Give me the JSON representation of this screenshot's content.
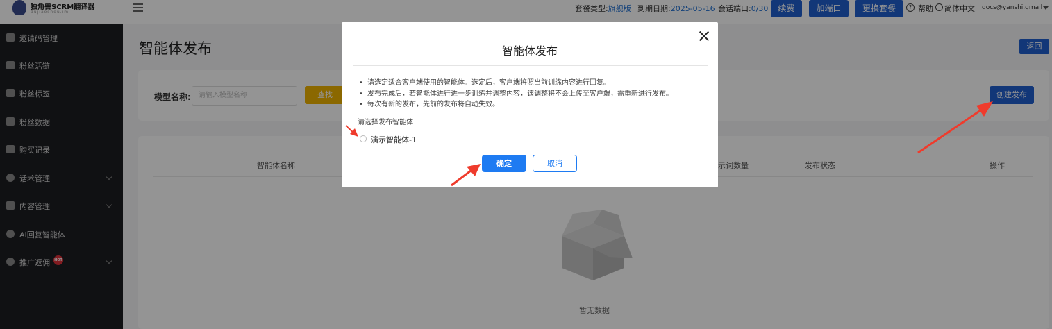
{
  "header": {
    "logo_title": "独角兽SCRM翻译器",
    "logo_subtitle": "dujiaoshou.im",
    "plan_label": "套餐类型:",
    "plan_value": "旗舰版",
    "expiry_label": "到期日期:",
    "expiry_value": "2025-05-16",
    "ports_label": "会话端口:",
    "ports_value": "0/30",
    "renew_button": "续费",
    "add_port_button": "加端口",
    "change_plan_button": "更换套餐",
    "help_label": "帮助",
    "language_label": "简体中文",
    "user_email": "docs@yanshi.gmail"
  },
  "sidebar": {
    "items": [
      {
        "label": "邀请码管理",
        "icon": "invite-icon",
        "has_children": false
      },
      {
        "label": "粉丝活链",
        "icon": "fans-icon",
        "has_children": false
      },
      {
        "label": "粉丝标签",
        "icon": "tag-icon",
        "has_children": false
      },
      {
        "label": "粉丝数据",
        "icon": "chart-icon",
        "has_children": false
      },
      {
        "label": "购买记录",
        "icon": "cart-icon",
        "has_children": false
      },
      {
        "label": "话术管理",
        "icon": "chat-icon",
        "has_children": true
      },
      {
        "label": "内容管理",
        "icon": "content-icon",
        "has_children": true
      },
      {
        "label": "AI回复智能体",
        "icon": "ai-icon",
        "has_children": false
      },
      {
        "label": "推广返佣",
        "icon": "promo-icon",
        "has_children": true,
        "badge": "HOT"
      }
    ]
  },
  "main": {
    "page_title": "智能体发布",
    "back_button": "返回",
    "filter_label": "模型名称:",
    "filter_placeholder": "请输入模型名称",
    "search_button": "查找",
    "create_button": "创建发布",
    "table_headers": [
      "智能体名称",
      "示词数量",
      "发布状态",
      "操作"
    ],
    "empty_text": "暂无数据"
  },
  "modal": {
    "title": "智能体发布",
    "notes": [
      "请选定适合客户端使用的智能体。选定后，客户端将照当前训练内容进行回复。",
      "发布完成后，若智能体进行进一步训练并调整内容，该调整将不会上传至客户端，需重新进行发布。",
      "每次有新的发布，先前的发布将自动失效。"
    ],
    "select_label": "请选择发布智能体",
    "option_label": "演示智能体-1",
    "option_selected": false,
    "confirm_button": "确定",
    "cancel_button": "取消"
  },
  "colors": {
    "primary": "#1f5fcf",
    "confirm": "#1e7bf2",
    "search": "#f0b400",
    "sidebar_bg": "#1d1e22",
    "annotation_arrow": "#ef3b2c",
    "hot_badge": "#e0313a"
  }
}
